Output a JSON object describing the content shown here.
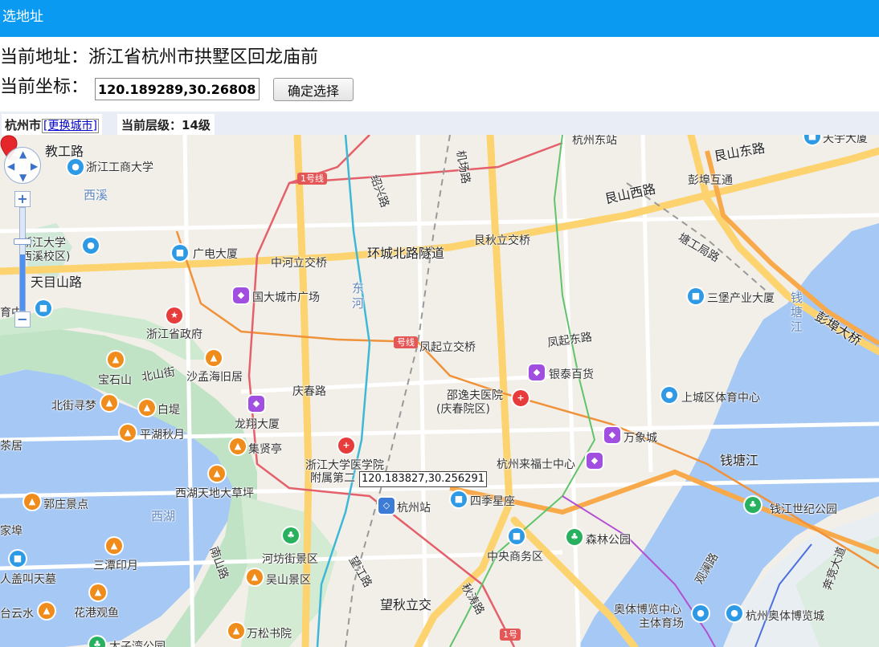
{
  "header": {
    "title": "选地址"
  },
  "address": {
    "label": "当前地址：",
    "value": "浙江省杭州市拱墅区回龙庙前"
  },
  "coordinate": {
    "label": "当前坐标：",
    "value": "120.189289,30.268082",
    "confirm_label": "确定选择"
  },
  "infobar": {
    "city": "杭州市",
    "change_city": "[更换城市]",
    "level_label": "当前层级：",
    "level_value": "14级"
  },
  "map": {
    "tooltip": "120.183827,30.256291",
    "zoom_level_fraction": 0.55,
    "metro_labels": [
      "1号线",
      "号线",
      "1号"
    ],
    "labels": {
      "jiaogonglu": "教工路",
      "zjgs": "浙江工商大学",
      "xixi": "西溪",
      "zju_xixi_1": "浙江大学",
      "zju_xixi_2": "西溪校区)",
      "tianmushan": "天目山路",
      "guangdian": "广电大厦",
      "zhonghe": "中河立交桥",
      "huancheng": "环城北路隧道",
      "genqiu": "艮秋立交桥",
      "genshanxi": "艮山西路",
      "genshandong": "艮山东路",
      "pengbu": "彭埠互通",
      "tanggong": "塘工局路",
      "guoda": "国大城市广场",
      "dong": "东",
      "he": "河",
      "sanbao": "三堡产业大厦",
      "zjgov": "浙江省政府",
      "fengqilijiao": "凤起立交桥",
      "fengqidong": "凤起东路",
      "yintai": "银泰百货",
      "qiantang_jiang1": "钱",
      "qiantang_jiang2": "塘",
      "qiantang_jiang3": "江",
      "pengbudaqiao": "彭埠大桥",
      "baoshi": "宝石山",
      "beishanjie": "北山街",
      "shamenghai": "沙孟海旧居",
      "qingchun": "庆春路",
      "shaoyifu1": "邵逸夫医院",
      "shaoyifu2": "(庆春院区)",
      "shangcheng": "上城区体育中心",
      "beijie": "北街寻梦",
      "baidi": "白堤",
      "longxiang": "龙翔大厦",
      "pinghu": "平湖秋月",
      "jixian": "集贤亭",
      "zjuyixue1": "浙江大学医学院",
      "zjuyixue2": "附属第二",
      "wanxiang": "万象城",
      "qiantangjiang": "钱塘江",
      "laifushi": "杭州来福士中心",
      "xihutiandi": "西湖天地大草坪",
      "guozhuang": "郭庄景点",
      "xihu": "西湖",
      "hangzhouzhan": "杭州站",
      "siji": "四季星座",
      "qianjiangshiji": "钱江世纪公园",
      "santan": "三潭印月",
      "nanshan": "南山路",
      "hefang": "河坊街景区",
      "wushan": "吴山景区",
      "zhongyang": "中央商务区",
      "senlin": "森林公园",
      "guanlan": "观澜路",
      "bensheng": "奔竞大道",
      "huagang": "花港观鱼",
      "wangjiang": "望江路",
      "wangqiu": "望秋立交",
      "qiutao": "秋涛路",
      "tiyu1": "奥体博览中心",
      "tiyu2": "主体育场",
      "bolan": "杭州奥体博览城",
      "wansong": "万松书院",
      "taiziwan": "太子湾公园",
      "taishui": "台云水",
      "gaipeng": "人盖叫天墓",
      "jiadi": "家埠",
      "chaju": "茶居",
      "youzhong": "育中",
      "shaoxing": "绍兴路",
      "jichang": "机场路",
      "hangzhoudong": "杭州东站",
      "tianyu": "天宇大厦"
    }
  }
}
